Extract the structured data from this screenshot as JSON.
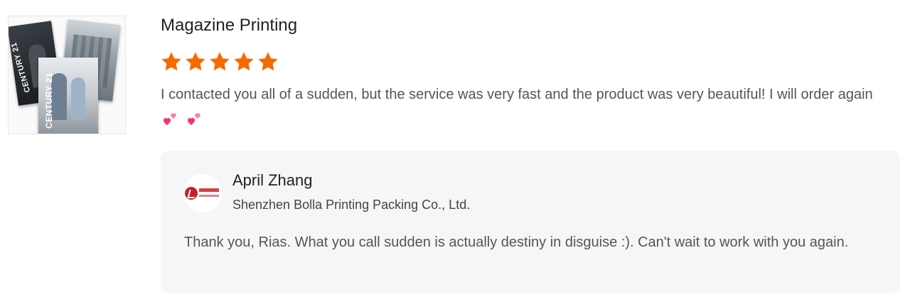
{
  "product": {
    "title": "Magazine Printing",
    "image_alt": "Magazine covers",
    "cover_texts": [
      "CENTURY 21",
      "CENTURY 21"
    ]
  },
  "rating": {
    "stars": 5,
    "max": 5,
    "color": "#f56a00"
  },
  "review": {
    "text": "I contacted you all of a sudden, but the service was very fast and the product was very beautiful! I will order again",
    "emoji_icons": [
      "two-hearts-icon",
      "two-hearts-icon"
    ]
  },
  "reply": {
    "name": "April Zhang",
    "company": "Shenzhen Bolla Printing Packing Co., Ltd.",
    "text": "Thank you, Rias. What you call sudden is actually destiny in disguise :). Can't wait to work with you again.",
    "avatar_icon": "company-logo-icon"
  },
  "colors": {
    "accent": "#f56a00",
    "heart": "#f0357a",
    "reply_bg": "#f5f6f8"
  }
}
